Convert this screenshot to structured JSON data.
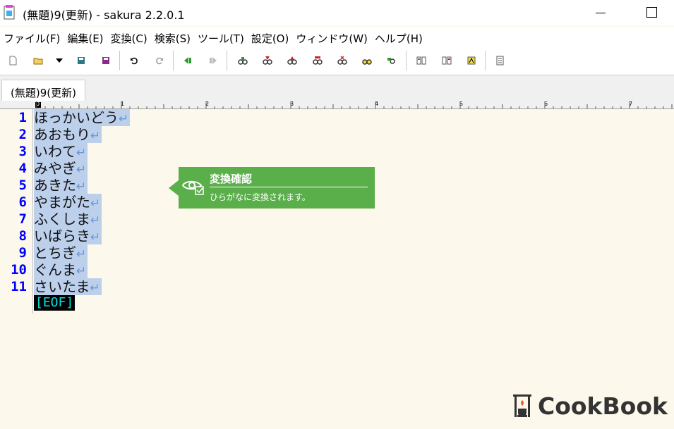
{
  "window": {
    "title": "(無題)9(更新) - sakura 2.2.0.1"
  },
  "menu": [
    {
      "label": "ファイル(F)"
    },
    {
      "label": "編集(E)"
    },
    {
      "label": "変換(C)"
    },
    {
      "label": "検索(S)"
    },
    {
      "label": "ツール(T)"
    },
    {
      "label": "設定(O)"
    },
    {
      "label": "ウィンドウ(W)"
    },
    {
      "label": "ヘルプ(H)"
    }
  ],
  "toolbar": {
    "icons": [
      "new-file-icon",
      "open-file-icon",
      "dropdown-arrow-icon",
      "save-icon",
      "save-as-icon",
      "undo-icon",
      "redo-icon",
      "jump-back-icon",
      "jump-forward-icon",
      "search-icon",
      "search-next-icon",
      "search-prev-icon",
      "replace-icon",
      "grep-icon",
      "grep-replace-icon",
      "jump-tag-icon",
      "compare-icon",
      "settings-icon",
      "font-icon",
      "outline-icon"
    ]
  },
  "tabs": [
    {
      "label": "(無題)9(更新)"
    }
  ],
  "ruler": {
    "marks": [
      "0",
      "1",
      "2",
      "3",
      "4",
      "5",
      "6",
      "7"
    ]
  },
  "editor": {
    "eol_mark": "↵",
    "eof_label": "[EOF]",
    "lines": [
      {
        "no": "1",
        "text": "ほっかいどう"
      },
      {
        "no": "2",
        "text": "あおもり"
      },
      {
        "no": "3",
        "text": "いわて"
      },
      {
        "no": "4",
        "text": "みやぎ"
      },
      {
        "no": "5",
        "text": "あきた"
      },
      {
        "no": "6",
        "text": "やまがた"
      },
      {
        "no": "7",
        "text": "ふくしま"
      },
      {
        "no": "8",
        "text": "いばらき"
      },
      {
        "no": "9",
        "text": "とちぎ"
      },
      {
        "no": "10",
        "text": "ぐんま"
      },
      {
        "no": "11",
        "text": "さいたま"
      }
    ]
  },
  "tooltip": {
    "title": "変換確認",
    "message": "ひらがなに変換されます。",
    "color": "#5aaf4a"
  },
  "logo": {
    "text": "CookBook"
  }
}
